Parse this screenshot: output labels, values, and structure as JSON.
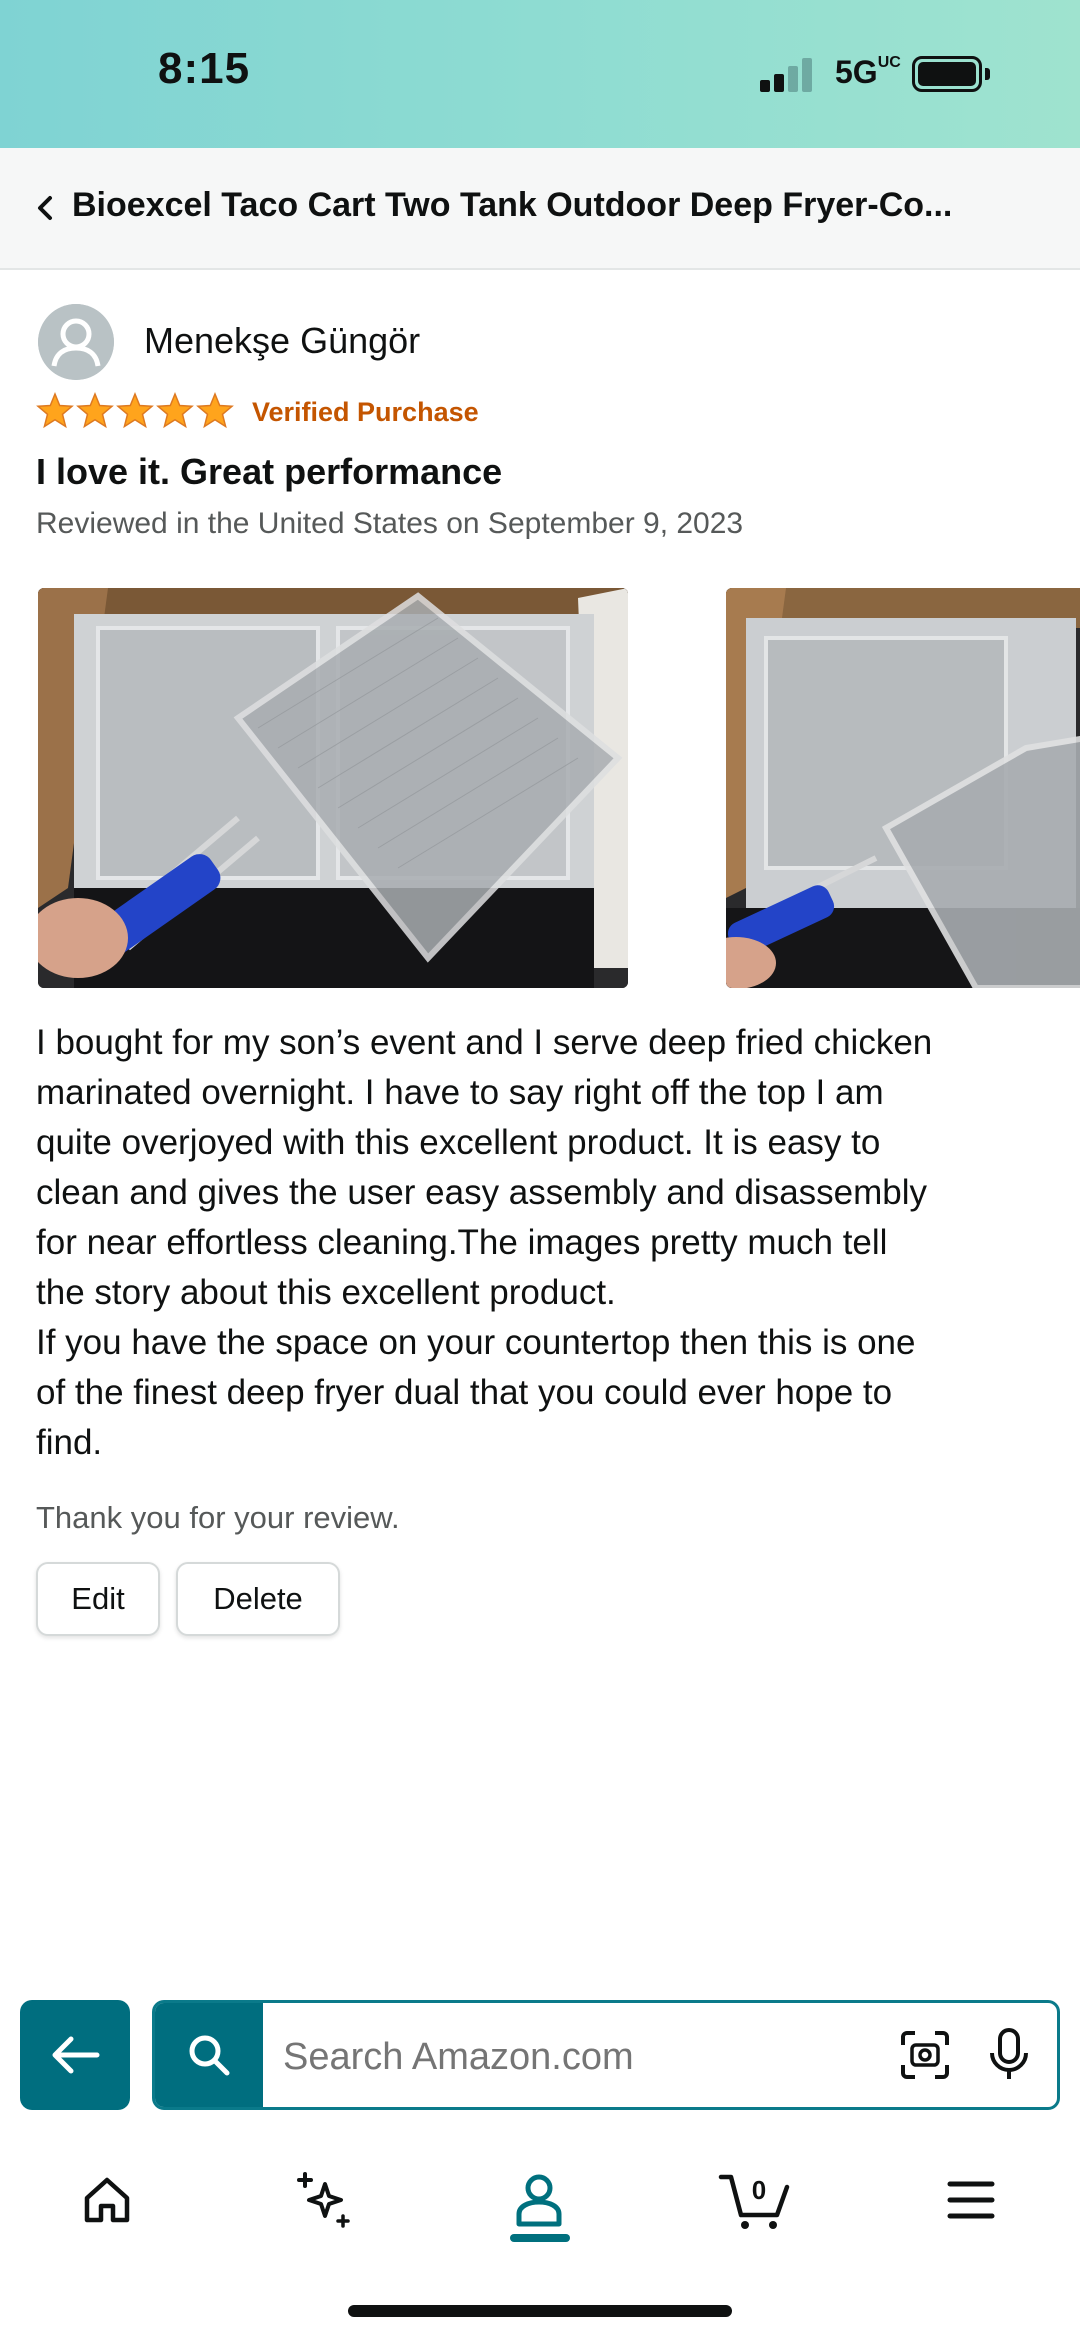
{
  "status_bar": {
    "time": "8:15",
    "network": "5G",
    "signal_bars": 2,
    "battery_level": 1.0
  },
  "header": {
    "title": "Bioexcel Taco Cart Two Tank Outdoor Deep Fryer-Co..."
  },
  "review": {
    "reviewer_name": "Menekşe Güngör",
    "rating": 5,
    "rating_max": 5,
    "verified_label": "Verified Purchase",
    "title": "I love it. Great performance",
    "date_text": "Reviewed in the United States on September 9, 2023",
    "body_lines": [
      "I bought for my son’s event and I serve deep fried chicken",
      "marinated overnight. I have to say right off the top I am",
      "quite overjoyed with this excellent product. It is easy to",
      "clean and gives the user easy assembly and disassembly",
      "for near effortless cleaning.The images pretty much tell",
      "the story about this excellent product.",
      "If you have the space on your countertop then this is one",
      "of the finest deep fryer dual that you could ever hope to",
      "find."
    ],
    "thank_you": "Thank you for your review.",
    "edit_label": "Edit",
    "delete_label": "Delete"
  },
  "search": {
    "placeholder": "Search Amazon.com"
  },
  "tabs": [
    {
      "name": "home",
      "icon": "home-icon",
      "active": false
    },
    {
      "name": "rufus",
      "icon": "sparkle-icon",
      "active": false
    },
    {
      "name": "account",
      "icon": "person-icon",
      "active": true
    },
    {
      "name": "cart",
      "icon": "cart-icon",
      "active": false,
      "badge": "0"
    },
    {
      "name": "menu",
      "icon": "hamburger-icon",
      "active": false
    }
  ],
  "colors": {
    "accent": "#006e7f",
    "star": "#ffa41c",
    "verified": "#c45500",
    "status_bar_left": "#7fd3d3",
    "status_bar_right": "#9fe3cf"
  }
}
